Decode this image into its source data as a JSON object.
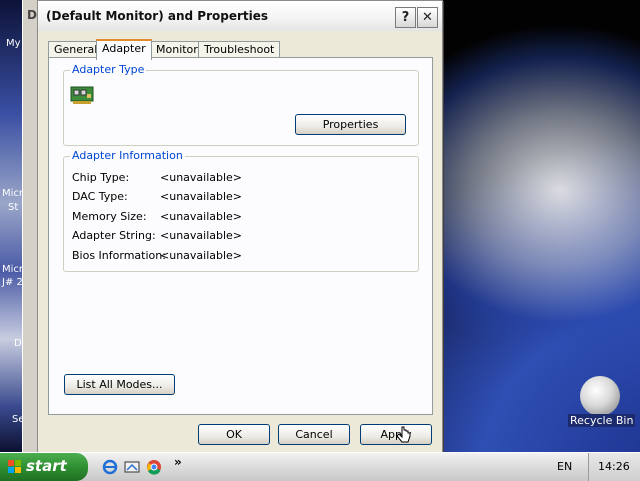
{
  "dialog": {
    "title": "(Default Monitor) and  Properties",
    "help_label": "?",
    "close_label": "✕",
    "tabs": [
      {
        "label": "General"
      },
      {
        "label": "Adapter"
      },
      {
        "label": "Monitor"
      },
      {
        "label": "Troubleshoot"
      }
    ],
    "active_tab": "Adapter",
    "adapter_type": {
      "group_label": "Adapter Type",
      "properties_button": "Properties"
    },
    "adapter_info": {
      "group_label": "Adapter Information",
      "rows": [
        {
          "label": "Chip Type:",
          "value": "<unavailable>"
        },
        {
          "label": "DAC Type:",
          "value": "<unavailable>"
        },
        {
          "label": "Memory Size:",
          "value": "<unavailable>"
        },
        {
          "label": "Adapter String:",
          "value": "<unavailable>"
        },
        {
          "label": "Bios Information:",
          "value": "<unavailable>"
        }
      ]
    },
    "list_all_modes_button": "List All Modes...",
    "ok_button": "OK",
    "cancel_button": "Cancel",
    "apply_button": "Apply"
  },
  "back_window": {
    "title_fragment": "D"
  },
  "desktop": {
    "icons_left": [
      "My",
      "Micr",
      "St",
      "Micr",
      "J# 2",
      "D",
      "Se"
    ],
    "recycle_bin_label": "Recycle Bin"
  },
  "taskbar": {
    "start_label": "start",
    "quick_launch": [
      "ie-icon",
      "desktop-icon",
      "chrome-icon"
    ],
    "overflow": "»",
    "language": "EN",
    "clock": "14:26"
  }
}
